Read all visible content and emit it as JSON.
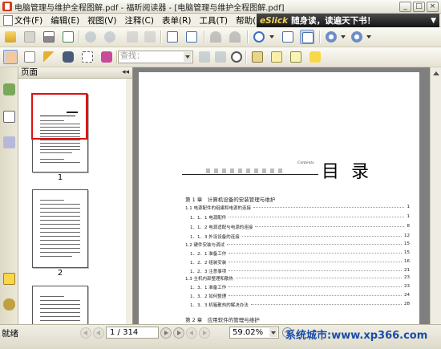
{
  "window": {
    "title": "电脑管理与维护全程图解.pdf - 福昕阅读器 - [电脑管理与维护全程图解.pdf]",
    "buttons": {
      "minimize": "_",
      "restore": "□",
      "close": "×"
    }
  },
  "menu": {
    "items": [
      "文件(F)",
      "编辑(E)",
      "视图(V)",
      "注释(C)",
      "表单(R)",
      "工具(T)",
      "帮助(H)"
    ]
  },
  "banner": {
    "brand": "eSlick",
    "text": "随身读，读遍天下书！",
    "arrow": "▼"
  },
  "toolbar": {
    "search_placeholder": "查找：",
    "icons": [
      "open-icon",
      "save-icon",
      "print-icon",
      "email-icon",
      "first-page-icon",
      "previous-page-icon",
      "next-page-icon",
      "last-page-icon",
      "page-layout-icon",
      "rotate-icon",
      "undo-icon",
      "redo-icon",
      "zoom-in-icon",
      "fit-page-icon",
      "fit-width-icon",
      "zoom-out-minus-icon",
      "zoom-in-plus-icon",
      "hand-tool-icon",
      "text-select-icon",
      "select-arrow-icon",
      "binoculars-icon",
      "snapshot-icon",
      "camera-icon",
      "find-next-icon",
      "typewriter-icon",
      "highlight-icon",
      "text-box-icon",
      "note-icon"
    ]
  },
  "side_panel": {
    "title": "页面",
    "collapse": "◂◂",
    "thumbnails": [
      {
        "label": "1",
        "selected": true
      },
      {
        "label": "2",
        "selected": false
      },
      {
        "label": "",
        "selected": false
      }
    ]
  },
  "document": {
    "heading": "目 录",
    "contents_label": "Contents",
    "toc": [
      {
        "text": "第 1 章　计算机设备的安装管理与维护",
        "page": "",
        "chapter": true
      },
      {
        "text": "1.1 电源配件的组建和电源的连接",
        "page": "1",
        "chapter": false
      },
      {
        "text": "1．1．1 电源配件",
        "page": "1",
        "chapter": false
      },
      {
        "text": "1．1．2 电源适配与电源的连接",
        "page": "8",
        "chapter": false
      },
      {
        "text": "1．1．3 外设设备的连接",
        "page": "12",
        "chapter": false
      },
      {
        "text": "1.2 硬件安装与调试",
        "page": "15",
        "chapter": false
      },
      {
        "text": "1．2．1 准备工作",
        "page": "15",
        "chapter": false
      },
      {
        "text": "1．2．2 组装安装",
        "page": "16",
        "chapter": false
      },
      {
        "text": "1．2．3 注意事项",
        "page": "21",
        "chapter": false
      },
      {
        "text": "1.3 主机内部整理和散热",
        "page": "23",
        "chapter": false
      },
      {
        "text": "1．3．1 准备工作",
        "page": "23",
        "chapter": false
      },
      {
        "text": "1．3．2 如何整理",
        "page": "24",
        "chapter": false
      },
      {
        "text": "1．3．3 机箱散热的解决办法",
        "page": "28",
        "chapter": false
      },
      {
        "text": "第 2 章　应用软件的管理与维护",
        "page": "",
        "chapter": true
      }
    ]
  },
  "status": {
    "ready": "就绪",
    "page_indicator": "1 / 314",
    "zoom": "59.02%",
    "zoom_out": "−",
    "zoom_in": "+",
    "watermark": "系统城市:www.xp366.com"
  }
}
